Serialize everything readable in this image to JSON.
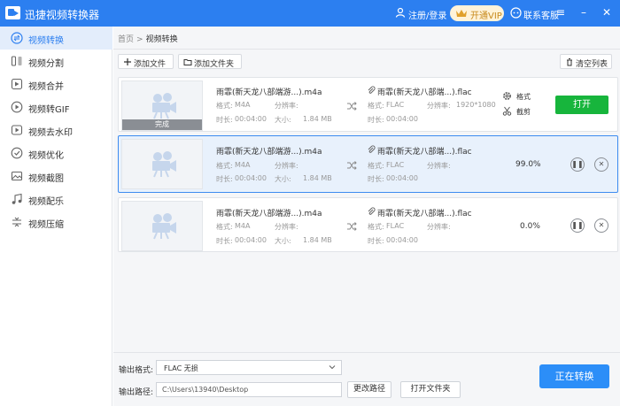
{
  "titlebar": {
    "app_title": "迅捷视频转换器",
    "login": "注册/登录",
    "vip": "开通VIP",
    "support": "联系客服"
  },
  "sidebar": {
    "items": [
      {
        "label": "视频转换",
        "icon": "convert-icon",
        "active": true
      },
      {
        "label": "视频分割",
        "icon": "split-icon"
      },
      {
        "label": "视频合并",
        "icon": "merge-icon"
      },
      {
        "label": "视频转GIF",
        "icon": "gif-icon"
      },
      {
        "label": "视频去水印",
        "icon": "watermark-icon"
      },
      {
        "label": "视频优化",
        "icon": "optimize-icon"
      },
      {
        "label": "视频截图",
        "icon": "screenshot-icon"
      },
      {
        "label": "视频配乐",
        "icon": "music-icon"
      },
      {
        "label": "视频压缩",
        "icon": "compress-icon"
      }
    ]
  },
  "breadcrumb": {
    "home": "首页",
    "sep": ">",
    "current": "视频转换"
  },
  "toolbar": {
    "add_file": "添加文件",
    "add_folder": "添加文件夹",
    "clear_list": "清空列表"
  },
  "labels": {
    "format": "格式:",
    "resolution": "分辨率:",
    "duration": "时长:",
    "size": "大小:"
  },
  "files": [
    {
      "src_name": "雨霏(新天龙八部端游...).m4a",
      "src_format": "M4A",
      "src_resolution": "",
      "src_duration": "00:04:00",
      "src_size": "1.84 MB",
      "dst_name": "雨霏(新天龙八部端...).flac",
      "dst_format": "FLAC",
      "dst_resolution": "1920*1080",
      "dst_duration": "00:04:00",
      "status": "完成",
      "opt_format": "格式",
      "opt_cut": "截剪",
      "open": "打开"
    },
    {
      "src_name": "雨霏(新天龙八部端游...).m4a",
      "src_format": "M4A",
      "src_resolution": "",
      "src_duration": "00:04:00",
      "src_size": "1.84 MB",
      "dst_name": "雨霏(新天龙八部端...).flac",
      "dst_format": "FLAC",
      "dst_resolution": "",
      "dst_duration": "00:04:00",
      "progress": "99.0%"
    },
    {
      "src_name": "雨霏(新天龙八部端游...).m4a",
      "src_format": "M4A",
      "src_resolution": "",
      "src_duration": "00:04:00",
      "src_size": "1.84 MB",
      "dst_name": "雨霏(新天龙八部端...).flac",
      "dst_format": "FLAC",
      "dst_resolution": "",
      "dst_duration": "00:04:00",
      "progress": "0.0%"
    }
  ],
  "bottom": {
    "output_format_label": "输出格式:",
    "output_format_value": "FLAC  无损",
    "output_path_label": "输出路径:",
    "output_path_value": "C:\\Users\\13940\\Desktop",
    "change_path": "更改路径",
    "open_folder": "打开文件夹",
    "convert": "正在转换"
  },
  "colors": {
    "accent": "#2c7ff0",
    "open_button": "#17b53c",
    "convert_button": "#2c8ef8",
    "vip_text": "#c78a1c"
  }
}
